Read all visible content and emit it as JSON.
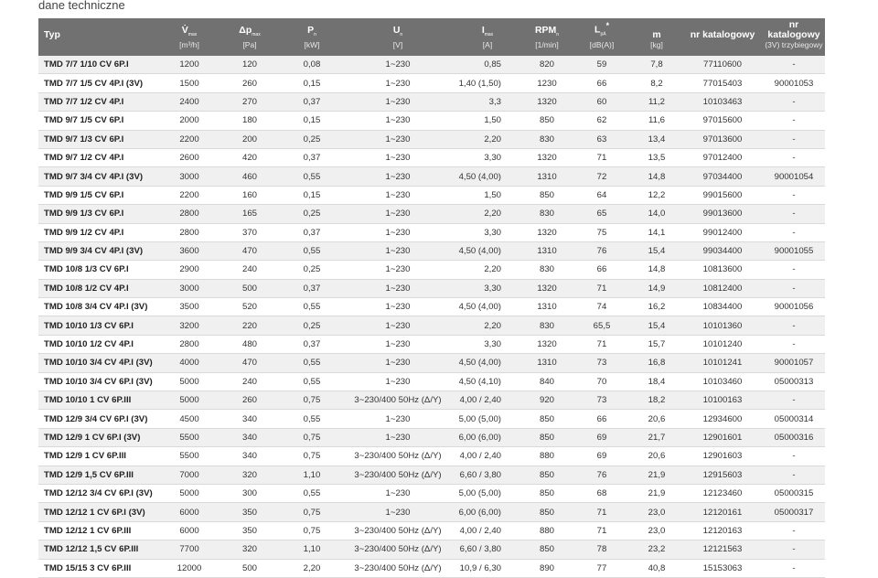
{
  "caption": "dane techniczne",
  "header": {
    "cols": [
      {
        "main": "Typ",
        "sub": "",
        "unit": ""
      },
      {
        "main": "V̇",
        "sub": "max",
        "unit": "[m³/h]"
      },
      {
        "main": "Δp",
        "sub": "max",
        "unit": "[Pa]"
      },
      {
        "main": "P",
        "sub": "n",
        "unit": "[kW]"
      },
      {
        "main": "U",
        "sub": "n",
        "unit": "[V]"
      },
      {
        "main": "I",
        "sub": "max",
        "unit": "[A]"
      },
      {
        "main": "RPM",
        "sub": "n",
        "unit": "[1/min]"
      },
      {
        "main": "L",
        "sub": "pA",
        "sup": "*",
        "unit": "[dB(A)]"
      },
      {
        "main": "m",
        "sub": "",
        "unit": "[kg]"
      },
      {
        "main": "nr katalogowy",
        "sub": "",
        "unit": ""
      },
      {
        "main": "nr katalogowy",
        "sub": "",
        "unit": "(3V) trzybiegowy"
      }
    ]
  },
  "rows": [
    [
      "TMD 7/7 1/10 CV 6P.I",
      "1200",
      "120",
      "0,08",
      "1~230",
      "0,85",
      "820",
      "59",
      "7,8",
      "77110600",
      "-"
    ],
    [
      "TMD 7/7 1/5 CV 4P.I (3V)",
      "1500",
      "260",
      "0,15",
      "1~230",
      "1,40 (1,50)",
      "1230",
      "66",
      "8,2",
      "77015403",
      "90001053"
    ],
    [
      "TMD 7/7 1/2 CV 4P.I",
      "2400",
      "270",
      "0,37",
      "1~230",
      "3,3",
      "1320",
      "60",
      "11,2",
      "10103463",
      "-"
    ],
    [
      "TMD 9/7 1/5 CV 6P.I",
      "2000",
      "180",
      "0,15",
      "1~230",
      "1,50",
      "850",
      "62",
      "11,6",
      "97015600",
      "-"
    ],
    [
      "TMD 9/7 1/3 CV 6P.I",
      "2200",
      "200",
      "0,25",
      "1~230",
      "2,20",
      "830",
      "63",
      "13,4",
      "97013600",
      "-"
    ],
    [
      "TMD 9/7 1/2 CV 4P.I",
      "2600",
      "420",
      "0,37",
      "1~230",
      "3,30",
      "1320",
      "71",
      "13,5",
      "97012400",
      "-"
    ],
    [
      "TMD 9/7 3/4 CV 4P.I (3V)",
      "3000",
      "460",
      "0,55",
      "1~230",
      "4,50 (4,00)",
      "1310",
      "72",
      "14,8",
      "97034400",
      "90001054"
    ],
    [
      "TMD 9/9 1/5 CV 6P.I",
      "2200",
      "160",
      "0,15",
      "1~230",
      "1,50",
      "850",
      "64",
      "12,2",
      "99015600",
      "-"
    ],
    [
      "TMD 9/9 1/3 CV 6P.I",
      "2800",
      "165",
      "0,25",
      "1~230",
      "2,20",
      "830",
      "65",
      "14,0",
      "99013600",
      "-"
    ],
    [
      "TMD 9/9 1/2 CV 4P.I",
      "2800",
      "370",
      "0,37",
      "1~230",
      "3,30",
      "1320",
      "75",
      "14,1",
      "99012400",
      "-"
    ],
    [
      "TMD 9/9 3/4 CV 4P.I (3V)",
      "3600",
      "470",
      "0,55",
      "1~230",
      "4,50 (4,00)",
      "1310",
      "76",
      "15,4",
      "99034400",
      "90001055"
    ],
    [
      "TMD 10/8 1/3 CV 6P.I",
      "2900",
      "240",
      "0,25",
      "1~230",
      "2,20",
      "830",
      "66",
      "14,8",
      "10813600",
      "-"
    ],
    [
      "TMD 10/8 1/2 CV 4P.I",
      "3000",
      "500",
      "0,37",
      "1~230",
      "3,30",
      "1320",
      "71",
      "14,9",
      "10812400",
      "-"
    ],
    [
      "TMD 10/8 3/4 CV 4P.I (3V)",
      "3500",
      "520",
      "0,55",
      "1~230",
      "4,50 (4,00)",
      "1310",
      "74",
      "16,2",
      "10834400",
      "90001056"
    ],
    [
      "TMD 10/10 1/3 CV 6P.I",
      "3200",
      "220",
      "0,25",
      "1~230",
      "2,20",
      "830",
      "65,5",
      "15,4",
      "10101360",
      "-"
    ],
    [
      "TMD 10/10 1/2 CV 4P.I",
      "2800",
      "480",
      "0,37",
      "1~230",
      "3,30",
      "1320",
      "71",
      "15,7",
      "10101240",
      "-"
    ],
    [
      "TMD 10/10 3/4 CV 4P.I (3V)",
      "4000",
      "470",
      "0,55",
      "1~230",
      "4,50 (4,00)",
      "1310",
      "73",
      "16,8",
      "10101241",
      "90001057"
    ],
    [
      "TMD 10/10 3/4 CV 6P.I (3V)",
      "5000",
      "240",
      "0,55",
      "1~230",
      "4,50 (4,10)",
      "840",
      "70",
      "18,4",
      "10103460",
      "05000313"
    ],
    [
      "TMD 10/10 1 CV 6P.III",
      "5000",
      "260",
      "0,75",
      "3~230/400 50Hz (Δ/Y)",
      "4,00 / 2,40",
      "920",
      "73",
      "18,2",
      "10100163",
      "-"
    ],
    [
      "TMD 12/9 3/4 CV 6P.I (3V)",
      "4500",
      "340",
      "0,55",
      "1~230",
      "5,00 (5,00)",
      "850",
      "66",
      "20,6",
      "12934600",
      "05000314"
    ],
    [
      "TMD 12/9 1 CV 6P.I (3V)",
      "5500",
      "340",
      "0,75",
      "1~230",
      "6,00 (6,00)",
      "850",
      "69",
      "21,7",
      "12901601",
      "05000316"
    ],
    [
      "TMD 12/9 1 CV 6P.III",
      "5500",
      "340",
      "0,75",
      "3~230/400 50Hz (Δ/Y)",
      "4,00 / 2,40",
      "880",
      "69",
      "20,6",
      "12901603",
      "-"
    ],
    [
      "TMD 12/9 1,5 CV 6P.III",
      "7000",
      "320",
      "1,10",
      "3~230/400 50Hz (Δ/Y)",
      "6,60 / 3,80",
      "850",
      "76",
      "21,9",
      "12915603",
      "-"
    ],
    [
      "TMD 12/12 3/4 CV 6P.I (3V)",
      "5000",
      "300",
      "0,55",
      "1~230",
      "5,00 (5,00)",
      "850",
      "68",
      "21,9",
      "12123460",
      "05000315"
    ],
    [
      "TMD 12/12 1 CV 6P.I (3V)",
      "6000",
      "350",
      "0,75",
      "1~230",
      "6,00 (6,00)",
      "850",
      "71",
      "23,0",
      "12120161",
      "05000317"
    ],
    [
      "TMD 12/12 1 CV 6P.III",
      "6000",
      "350",
      "0,75",
      "3~230/400 50Hz (Δ/Y)",
      "4,00 / 2,40",
      "880",
      "71",
      "23,0",
      "12120163",
      "-"
    ],
    [
      "TMD 12/12 1,5 CV 6P.III",
      "7700",
      "320",
      "1,10",
      "3~230/400 50Hz (Δ/Y)",
      "6,60 / 3,80",
      "850",
      "78",
      "23,2",
      "12121563",
      "-"
    ],
    [
      "TMD 15/15 3 CV 6P.III",
      "12000",
      "500",
      "2,20",
      "3~230/400 50Hz (Δ/Y)",
      "10,9 / 6,30",
      "890",
      "77",
      "40,8",
      "15153063",
      "-"
    ]
  ]
}
